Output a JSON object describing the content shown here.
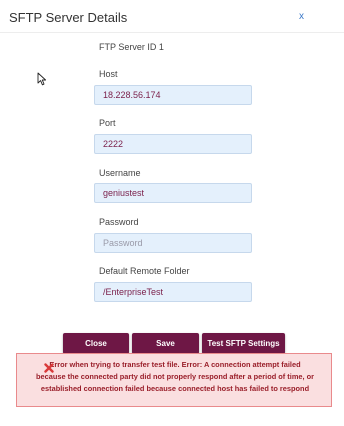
{
  "dialog": {
    "title": "SFTP Server Details",
    "close_label": "x"
  },
  "form": {
    "server_id_label": "FTP Server ID 1",
    "host": {
      "label": "Host",
      "value": "18.228.56.174"
    },
    "port": {
      "label": "Port",
      "value": "2222"
    },
    "username": {
      "label": "Username",
      "value": "geniustest"
    },
    "password": {
      "label": "Password",
      "value": "",
      "placeholder": "Password"
    },
    "remote_folder": {
      "label": "Default Remote Folder",
      "value": "/EnterpriseTest"
    }
  },
  "buttons": {
    "close_label": "Close",
    "save_label": "Save",
    "test_label": "Test SFTP Settings"
  },
  "error": {
    "line1": "Error when trying to transfer test file. Error: A connection attempt failed",
    "line2": "because the connected party did not properly respond after a period of time, or",
    "line3": "established connection failed because connected host has failed to respond"
  },
  "colors": {
    "button_bg": "#6e1745",
    "input_bg": "#e4f0fc",
    "error_bg": "#fadfe0",
    "error_text": "#9a1f2a",
    "error_icon": "#d93a3a",
    "close_link": "#3a78c8"
  },
  "icons": {
    "error": "error-x-icon",
    "cursor": "mouse-pointer-icon"
  }
}
